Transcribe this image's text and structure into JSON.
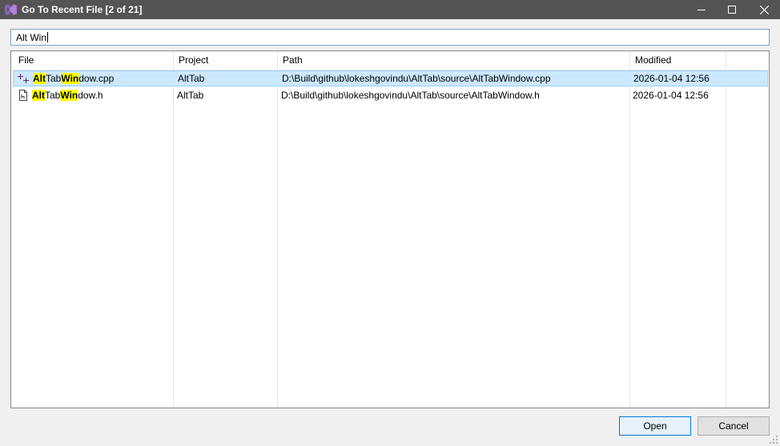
{
  "window": {
    "title": "Go To Recent File [2 of 21]",
    "accent": "#545454"
  },
  "search": {
    "value": "Alt Win"
  },
  "columns": {
    "file": "File",
    "project": "Project",
    "path": "Path",
    "modified": "Modified"
  },
  "rows": [
    {
      "icon": "cpp-file-icon",
      "file_parts": [
        {
          "text": "Alt",
          "hl": true
        },
        {
          "text": "Tab",
          "hl": false
        },
        {
          "text": "Win",
          "hl": true
        },
        {
          "text": "dow.cpp",
          "hl": false
        }
      ],
      "project": "AltTab",
      "path": "D:\\Build\\github\\lokeshgovindu\\AltTab\\source\\AltTabWindow.cpp",
      "modified": "2026-01-04 12:56",
      "selected": true
    },
    {
      "icon": "header-file-icon",
      "file_parts": [
        {
          "text": "Alt",
          "hl": true
        },
        {
          "text": "Tab",
          "hl": false
        },
        {
          "text": "Win",
          "hl": true
        },
        {
          "text": "dow.h",
          "hl": false
        }
      ],
      "project": "AltTab",
      "path": "D:\\Build\\github\\lokeshgovindu\\AltTab\\source\\AltTabWindow.h",
      "modified": "2026-01-04 12:56",
      "selected": false
    }
  ],
  "buttons": {
    "open": "Open",
    "cancel": "Cancel"
  },
  "colors": {
    "selection": "#cce8ff",
    "highlight": "#ffff00",
    "brand_icon": "#68217a"
  }
}
